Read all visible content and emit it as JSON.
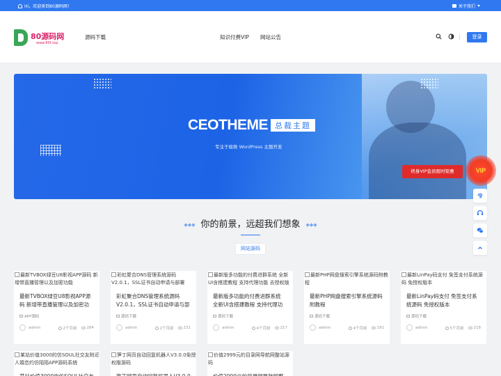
{
  "topbar": {
    "welcome": "Hi，欢迎来到80源码网！",
    "about": "关于我们"
  },
  "logo": {
    "title": "80源码网",
    "subtitle": "www.80t.top"
  },
  "nav": {
    "item1": "源码下载",
    "item2": "知识付费VIP",
    "item3": "网站公告"
  },
  "header": {
    "login": "登录"
  },
  "banner": {
    "brand": "CEOTHEME",
    "brand_tag": "总裁主题",
    "slogan": "专注于极致 WordPress 主题开发",
    "vip_cta": "终身VIP会员限时钜惠",
    "vip_badge": "VIP"
  },
  "section": {
    "title": "你的前景，远超我们想象",
    "tab": "网站源码"
  },
  "cards": [
    {
      "thumb": "最新TVBOX绿豆U8影视APP源码 新增带直播管理以及加密功能",
      "title": "最新TVBOX绿豆U8影视APP源码 新增带直播管理以及加密功能",
      "category": "APP源码",
      "author": "admin",
      "time": "2个月前",
      "views": "284"
    },
    {
      "thumb": "彩虹聚合DNS管理系统源码V2.0.1，SSL证书自动申请与部署",
      "title": "彩虹聚合DNS管理系统源码V2.0.1，SSL证书自动申请与部署",
      "category": "源码下载",
      "author": "admin",
      "time": "2个月前",
      "views": "231"
    },
    {
      "thumb": "最新版多功能的付费进群系统 全新UI含搭建教程 支持代理功能 去授权版",
      "title": "最新版多功能的付费进群系统 全新UI含搭建教程 支持代理功能",
      "category": "源码下载",
      "author": "admin",
      "time": "4个月前",
      "views": "217"
    },
    {
      "thumb": "最新PHP网盘搜索引擎系统源码附教程",
      "title": "最新PHP网盘搜索引擎系统源码 附教程",
      "category": "源码下载",
      "author": "admin",
      "time": "4个月前",
      "views": "191"
    },
    {
      "thumb": "最新LinPay码支付 免签支付系统源码 免授权版本",
      "title": "最新LinPay码支付 免签支付系统源码 免授权版本",
      "category": "源码下载",
      "author": "admin",
      "time": "5个月前",
      "views": "218"
    },
    {
      "thumb": "某站价值3000的仿SOUL社交友附近人婚恋约仿陌陌APP源码系统",
      "title": "某站价值3000的仿SOUL社交友",
      "category": "",
      "author": "",
      "time": "",
      "views": ""
    },
    {
      "thumb": "笋丁网页自动回复机器人V3.0.0免授权版源码",
      "title": "笋丁网页自动回复机器人V3.0.0",
      "category": "",
      "author": "",
      "time": "",
      "views": ""
    },
    {
      "thumb": "价值2999元的目录网导航网整站源码",
      "title": "价值2999元的目录网导航网整站",
      "category": "",
      "author": "",
      "time": "",
      "views": ""
    }
  ],
  "colors": {
    "accent": "#2f78f0",
    "vip_red": "#e02b2b",
    "logo": "#d9266b",
    "logo_green": "#3aa657"
  },
  "icons": [
    "bell-icon",
    "flag-icon",
    "search-icon",
    "theme-toggle-icon",
    "fingerprint-icon",
    "headset-icon",
    "wechat-icon",
    "back-to-top-icon",
    "eye-icon",
    "clock-icon",
    "category-icon",
    "avatar-icon"
  ]
}
